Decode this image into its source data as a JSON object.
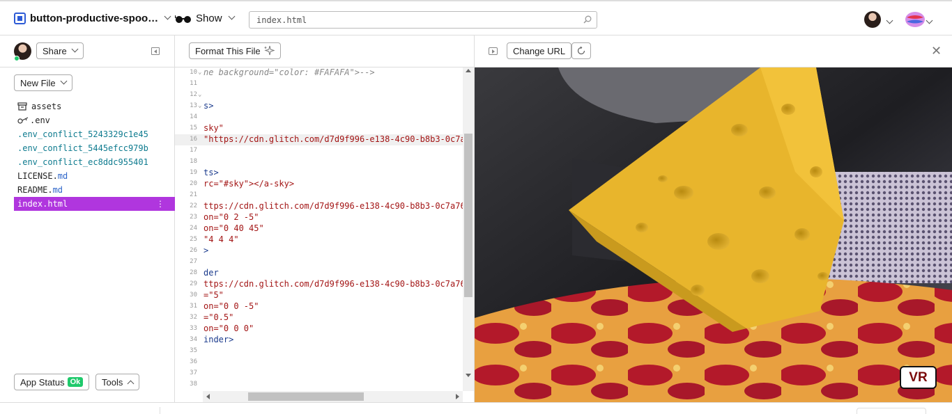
{
  "topbar": {
    "project_name": "button-productive-spoo…",
    "show_label": "Show",
    "search_value": "index.html"
  },
  "sidebar": {
    "share_label": "Share",
    "new_file_label": "New File",
    "files": [
      {
        "icon": "archive-icon",
        "name": "assets",
        "ext": ""
      },
      {
        "icon": "key-icon",
        "name": ".env",
        "ext": ""
      },
      {
        "icon": "",
        "name": ".env_conflict_5243329c1e45",
        "ext": ""
      },
      {
        "icon": "",
        "name": ".env_conflict_5445efcc979b",
        "ext": ""
      },
      {
        "icon": "",
        "name": ".env_conflict_ec8ddc955401",
        "ext": ""
      },
      {
        "icon": "",
        "name": "LICENSE.",
        "ext": "md"
      },
      {
        "icon": "",
        "name": "README.",
        "ext": "md"
      },
      {
        "icon": "",
        "name": "index.html",
        "ext": ""
      }
    ],
    "app_status_label": "App Status",
    "app_status_badge": "Ok",
    "tools_label": "Tools"
  },
  "editor": {
    "format_label": "Format This File",
    "lines": [
      {
        "n": "10",
        "text": "ne background=\"color: #FAFAFA\">-->",
        "kind": "comment",
        "fold": true
      },
      {
        "n": "11",
        "text": "",
        "kind": "plain",
        "fold": false
      },
      {
        "n": "12",
        "text": "",
        "kind": "plain",
        "fold": true
      },
      {
        "n": "13",
        "text": "s>",
        "kind": "tag",
        "fold": true
      },
      {
        "n": "14",
        "text": "",
        "kind": "plain",
        "fold": false
      },
      {
        "n": "15",
        "text": "sky\"",
        "kind": "str",
        "fold": false
      },
      {
        "n": "16",
        "text": "\"https://cdn.glitch.com/d7d9f996-e138-4c90-b8b3-0c7a",
        "kind": "str",
        "fold": false
      },
      {
        "n": "17",
        "text": "",
        "kind": "plain",
        "fold": false
      },
      {
        "n": "18",
        "text": "",
        "kind": "plain",
        "fold": false
      },
      {
        "n": "19",
        "text": "ts>",
        "kind": "tag",
        "fold": false
      },
      {
        "n": "20",
        "text": "rc=\"#sky\"></a-sky>",
        "kind": "mix",
        "fold": false
      },
      {
        "n": "21",
        "text": "",
        "kind": "plain",
        "fold": false
      },
      {
        "n": "22",
        "text": "ttps://cdn.glitch.com/d7d9f996-e138-4c90-b8b3-0c7a76",
        "kind": "str",
        "fold": false
      },
      {
        "n": "23",
        "text": "on=\"0 2 -5\"",
        "kind": "str",
        "fold": false
      },
      {
        "n": "24",
        "text": "on=\"0 40 45\"",
        "kind": "str",
        "fold": false
      },
      {
        "n": "25",
        "text": "\"4 4 4\"",
        "kind": "str",
        "fold": false
      },
      {
        "n": "26",
        "text": ">",
        "kind": "tag",
        "fold": false
      },
      {
        "n": "27",
        "text": "",
        "kind": "plain",
        "fold": false
      },
      {
        "n": "28",
        "text": "der",
        "kind": "tag",
        "fold": false
      },
      {
        "n": "29",
        "text": "ttps://cdn.glitch.com/d7d9f996-e138-4c90-b8b3-0c7a76",
        "kind": "str",
        "fold": false
      },
      {
        "n": "30",
        "text": "=\"5\"",
        "kind": "str",
        "fold": false
      },
      {
        "n": "31",
        "text": "on=\"0 0 -5\"",
        "kind": "str",
        "fold": false
      },
      {
        "n": "32",
        "text": "=\"0.5\"",
        "kind": "str",
        "fold": false
      },
      {
        "n": "33",
        "text": "on=\"0 0 0\"",
        "kind": "str",
        "fold": false
      },
      {
        "n": "34",
        "text": "inder>",
        "kind": "tag",
        "fold": false
      },
      {
        "n": "35",
        "text": "",
        "kind": "plain",
        "fold": false
      },
      {
        "n": "36",
        "text": "",
        "kind": "plain",
        "fold": false
      },
      {
        "n": "37",
        "text": "",
        "kind": "plain",
        "fold": false
      },
      {
        "n": "38",
        "text": "",
        "kind": "plain",
        "fold": false
      }
    ]
  },
  "preview": {
    "change_url_label": "Change URL",
    "vr_label": "VR"
  },
  "colors": {
    "accent": "#b036de",
    "ok_green": "#1fc96b",
    "teal_file": "#0e7b8f",
    "ext_blue": "#2e65c9"
  }
}
